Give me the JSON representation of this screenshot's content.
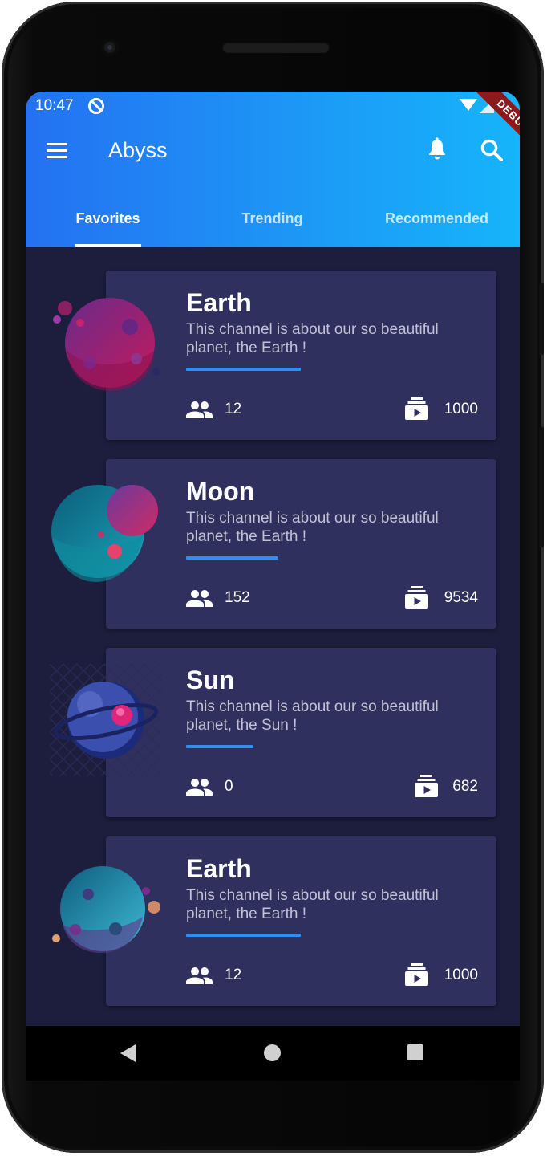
{
  "status_bar": {
    "time": "10:47",
    "debug_label": "DEBUG"
  },
  "app_bar": {
    "title": "Abyss"
  },
  "tabs": [
    {
      "label": "Favorites",
      "active": true
    },
    {
      "label": "Trending",
      "active": false
    },
    {
      "label": "Recommended",
      "active": false
    }
  ],
  "channels": [
    {
      "title": "Earth",
      "description": "This channel is about our so beautiful planet, the Earth !",
      "subscribers": "12",
      "videos": "1000",
      "progress": 0.51
    },
    {
      "title": "Moon",
      "description": "This channel is about our so beautiful planet, the Earth !",
      "subscribers": "152",
      "videos": "9534",
      "progress": 0.41
    },
    {
      "title": "Sun",
      "description": "This channel is about our so beautiful planet, the Sun !",
      "subscribers": "0",
      "videos": "682",
      "progress": 0.3
    },
    {
      "title": "Earth",
      "description": "This channel is about our so beautiful planet, the Earth !",
      "subscribers": "12",
      "videos": "1000",
      "progress": 0.51
    }
  ],
  "colors": {
    "header_start": "#2471f2",
    "header_end": "#16b4fb",
    "background": "#1d1e3d",
    "card": "#30305e",
    "accent_bar": "#2f8ff0"
  },
  "icons": [
    "menu-icon",
    "bell-icon",
    "search-icon",
    "people-icon",
    "video-library-icon",
    "back-icon",
    "home-icon",
    "recents-icon"
  ]
}
